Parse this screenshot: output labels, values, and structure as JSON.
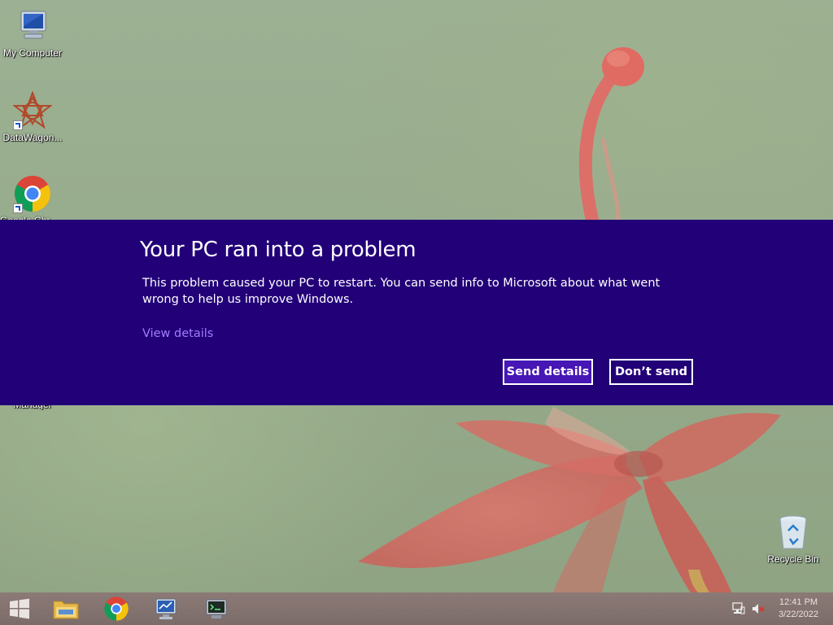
{
  "desktop": {
    "icons": [
      {
        "label": "My Computer",
        "icon": "my-computer-icon"
      },
      {
        "label": "DataWagon...",
        "icon": "datawagon-icon"
      },
      {
        "label": "Google Chrome",
        "icon": "chrome-icon"
      },
      {
        "label": "Manager",
        "icon": "manager-icon"
      },
      {
        "label": "Recycle Bin",
        "icon": "recycle-bin-icon"
      }
    ]
  },
  "error_banner": {
    "title": "Your PC ran into a problem",
    "message": "This problem caused your PC to restart. You can send info to Microsoft about what went wrong to help us improve Windows.",
    "view_details": "View details",
    "send_button": "Send details",
    "dont_send_button": "Don’t send",
    "colors": {
      "background": "#220078",
      "send_button": "#4617b4",
      "link": "#a07cff"
    }
  },
  "taskbar": {
    "pinned": [
      {
        "name": "start-button",
        "icon": "windows-logo-icon"
      },
      {
        "name": "file-explorer",
        "icon": "folder-icon"
      },
      {
        "name": "chrome",
        "icon": "chrome-icon"
      },
      {
        "name": "monitor-app",
        "icon": "monitor-icon"
      },
      {
        "name": "terminal-app",
        "icon": "terminal-icon"
      }
    ],
    "tray": {
      "network_icon": "network-icon",
      "volume_icon": "volume-muted-icon",
      "time": "12:41 PM",
      "date": "3/22/2022"
    }
  }
}
